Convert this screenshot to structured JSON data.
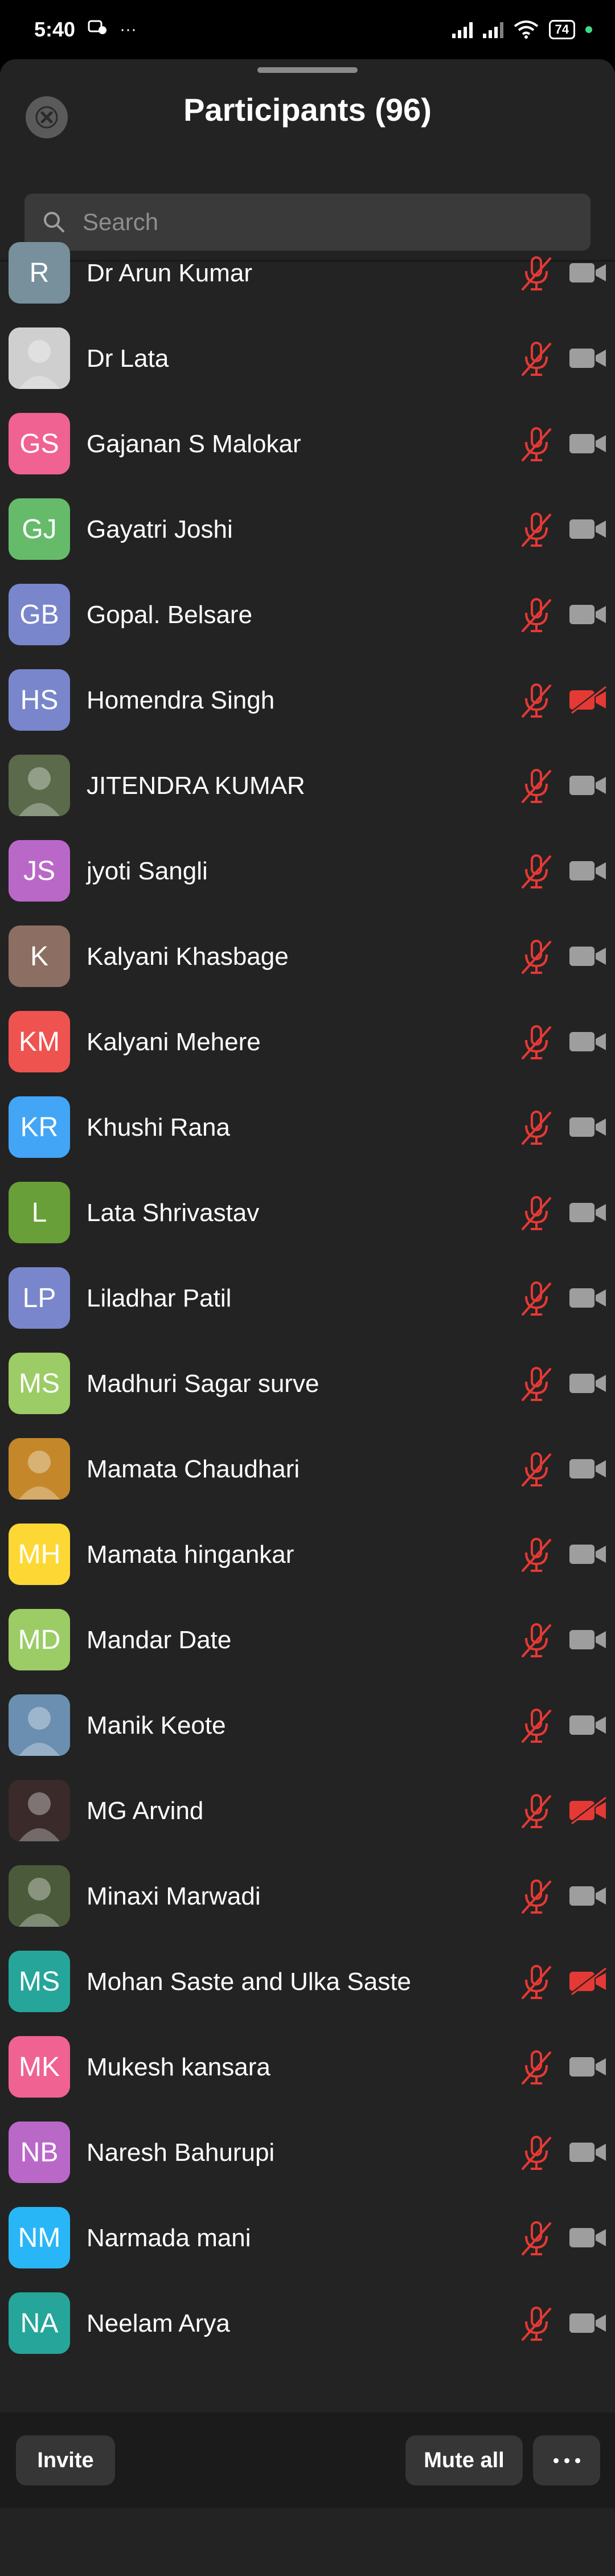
{
  "status_bar": {
    "time": "5:40",
    "battery": "74",
    "dots": "···"
  },
  "header": {
    "title": "Participants (96)"
  },
  "search": {
    "placeholder": "Search"
  },
  "participants": [
    {
      "name": "Dr Arun Kumar",
      "initials": "R",
      "color": "#78909c",
      "photo": false,
      "video_off": false
    },
    {
      "name": "Dr Lata",
      "initials": "",
      "color": "#cfcfcf",
      "photo": true,
      "video_off": false
    },
    {
      "name": "Gajanan S Malokar",
      "initials": "GS",
      "color": "#f06292",
      "photo": false,
      "video_off": false
    },
    {
      "name": "Gayatri Joshi",
      "initials": "GJ",
      "color": "#66bb6a",
      "photo": false,
      "video_off": false
    },
    {
      "name": "Gopal. Belsare",
      "initials": "GB",
      "color": "#7986cb",
      "photo": false,
      "video_off": false
    },
    {
      "name": "Homendra Singh",
      "initials": "HS",
      "color": "#7986cb",
      "photo": false,
      "video_off": true
    },
    {
      "name": "JITENDRA KUMAR",
      "initials": "",
      "color": "#5a6a4a",
      "photo": true,
      "video_off": false
    },
    {
      "name": "jyoti Sangli",
      "initials": "JS",
      "color": "#ba68c8",
      "photo": false,
      "video_off": false
    },
    {
      "name": "Kalyani Khasbage",
      "initials": "K",
      "color": "#8d6e63",
      "photo": false,
      "video_off": false
    },
    {
      "name": "Kalyani Mehere",
      "initials": "KM",
      "color": "#ef5350",
      "photo": false,
      "video_off": false
    },
    {
      "name": "Khushi Rana",
      "initials": "KR",
      "color": "#42a5f5",
      "photo": false,
      "video_off": false
    },
    {
      "name": "Lata Shrivastav",
      "initials": "L",
      "color": "#689f38",
      "photo": false,
      "video_off": false
    },
    {
      "name": "Liladhar Patil",
      "initials": "LP",
      "color": "#7986cb",
      "photo": false,
      "video_off": false
    },
    {
      "name": "Madhuri Sagar surve",
      "initials": "MS",
      "color": "#9ccc65",
      "photo": false,
      "video_off": false
    },
    {
      "name": "Mamata Chaudhari",
      "initials": "",
      "color": "#c4882a",
      "photo": true,
      "video_off": false
    },
    {
      "name": "Mamata hingankar",
      "initials": "MH",
      "color": "#fdd835",
      "photo": false,
      "video_off": false
    },
    {
      "name": "Mandar Date",
      "initials": "MD",
      "color": "#9ccc65",
      "photo": false,
      "video_off": false
    },
    {
      "name": "Manik Keote",
      "initials": "",
      "color": "#6a8fb0",
      "photo": true,
      "video_off": false
    },
    {
      "name": "MG Arvind",
      "initials": "",
      "color": "#3a2a2a",
      "photo": true,
      "video_off": true
    },
    {
      "name": "Minaxi Marwadi",
      "initials": "",
      "color": "#4a5a3a",
      "photo": true,
      "video_off": false
    },
    {
      "name": "Mohan Saste and Ulka Saste",
      "initials": "MS",
      "color": "#26a69a",
      "photo": false,
      "video_off": true
    },
    {
      "name": "Mukesh kansara",
      "initials": "MK",
      "color": "#f06292",
      "photo": false,
      "video_off": false
    },
    {
      "name": "Naresh Bahurupi",
      "initials": "NB",
      "color": "#ba68c8",
      "photo": false,
      "video_off": false
    },
    {
      "name": "Narmada mani",
      "initials": "NM",
      "color": "#29b6f6",
      "photo": false,
      "video_off": false
    },
    {
      "name": "Neelam Arya",
      "initials": "NA",
      "color": "#26a69a",
      "photo": false,
      "video_off": false
    }
  ],
  "footer": {
    "invite_label": "Invite",
    "mute_all_label": "Mute all"
  },
  "colors": {
    "mic_muted": "#e53935",
    "video_on": "#9e9e9e",
    "video_off": "#e53935"
  }
}
